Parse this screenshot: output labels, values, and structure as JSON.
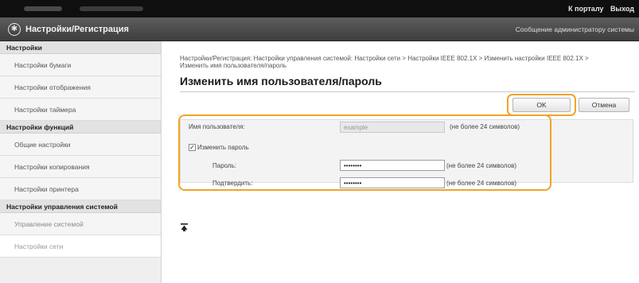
{
  "topbar": {
    "links": [
      "К порталу",
      "Выход"
    ]
  },
  "titlebar": {
    "logo_glyph": "✱",
    "title": "Настройки/Регистрация",
    "message": "Сообщение администратору системы"
  },
  "sidebar": {
    "groups": [
      {
        "header": "Настройки",
        "items": [
          "Настройки бумаги",
          "Настройки отображения",
          "Настройки таймера"
        ]
      },
      {
        "header": "Настройки функций",
        "items": [
          "Общие настройки",
          "Настройки копирования",
          "Настройки принтера"
        ]
      },
      {
        "header": "Настройки управления системой",
        "items": [
          "Управление системой",
          "Настройки сети"
        ]
      }
    ]
  },
  "main": {
    "breadcrumb": "Настройки/Регистрация: Настройки управления системой: Настройки сети > Настройки IEEE 802.1X > Изменить настройки IEEE 802.1X > Изменить имя пользователя/пароль",
    "title": "Изменить имя пользователя/пароль",
    "ok_label": "OK",
    "cancel_label": "Отмена",
    "form": {
      "username_label": "Имя пользователя:",
      "username_value": "example",
      "username_hint": "(не более 24 символов)",
      "change_password_label": "Изменить пароль",
      "change_password_checked": "✓",
      "password_label": "Пароль:",
      "password_value": "••••••••",
      "password_hint": "(не более 24 символов)",
      "confirm_label": "Подтвердить:",
      "confirm_value": "••••••••",
      "confirm_hint": "(не более 24 символов)"
    }
  },
  "colors": {
    "highlight": "#f0a428",
    "topbar": "#0f0f0f",
    "titlebar": "#4a4a4a"
  }
}
